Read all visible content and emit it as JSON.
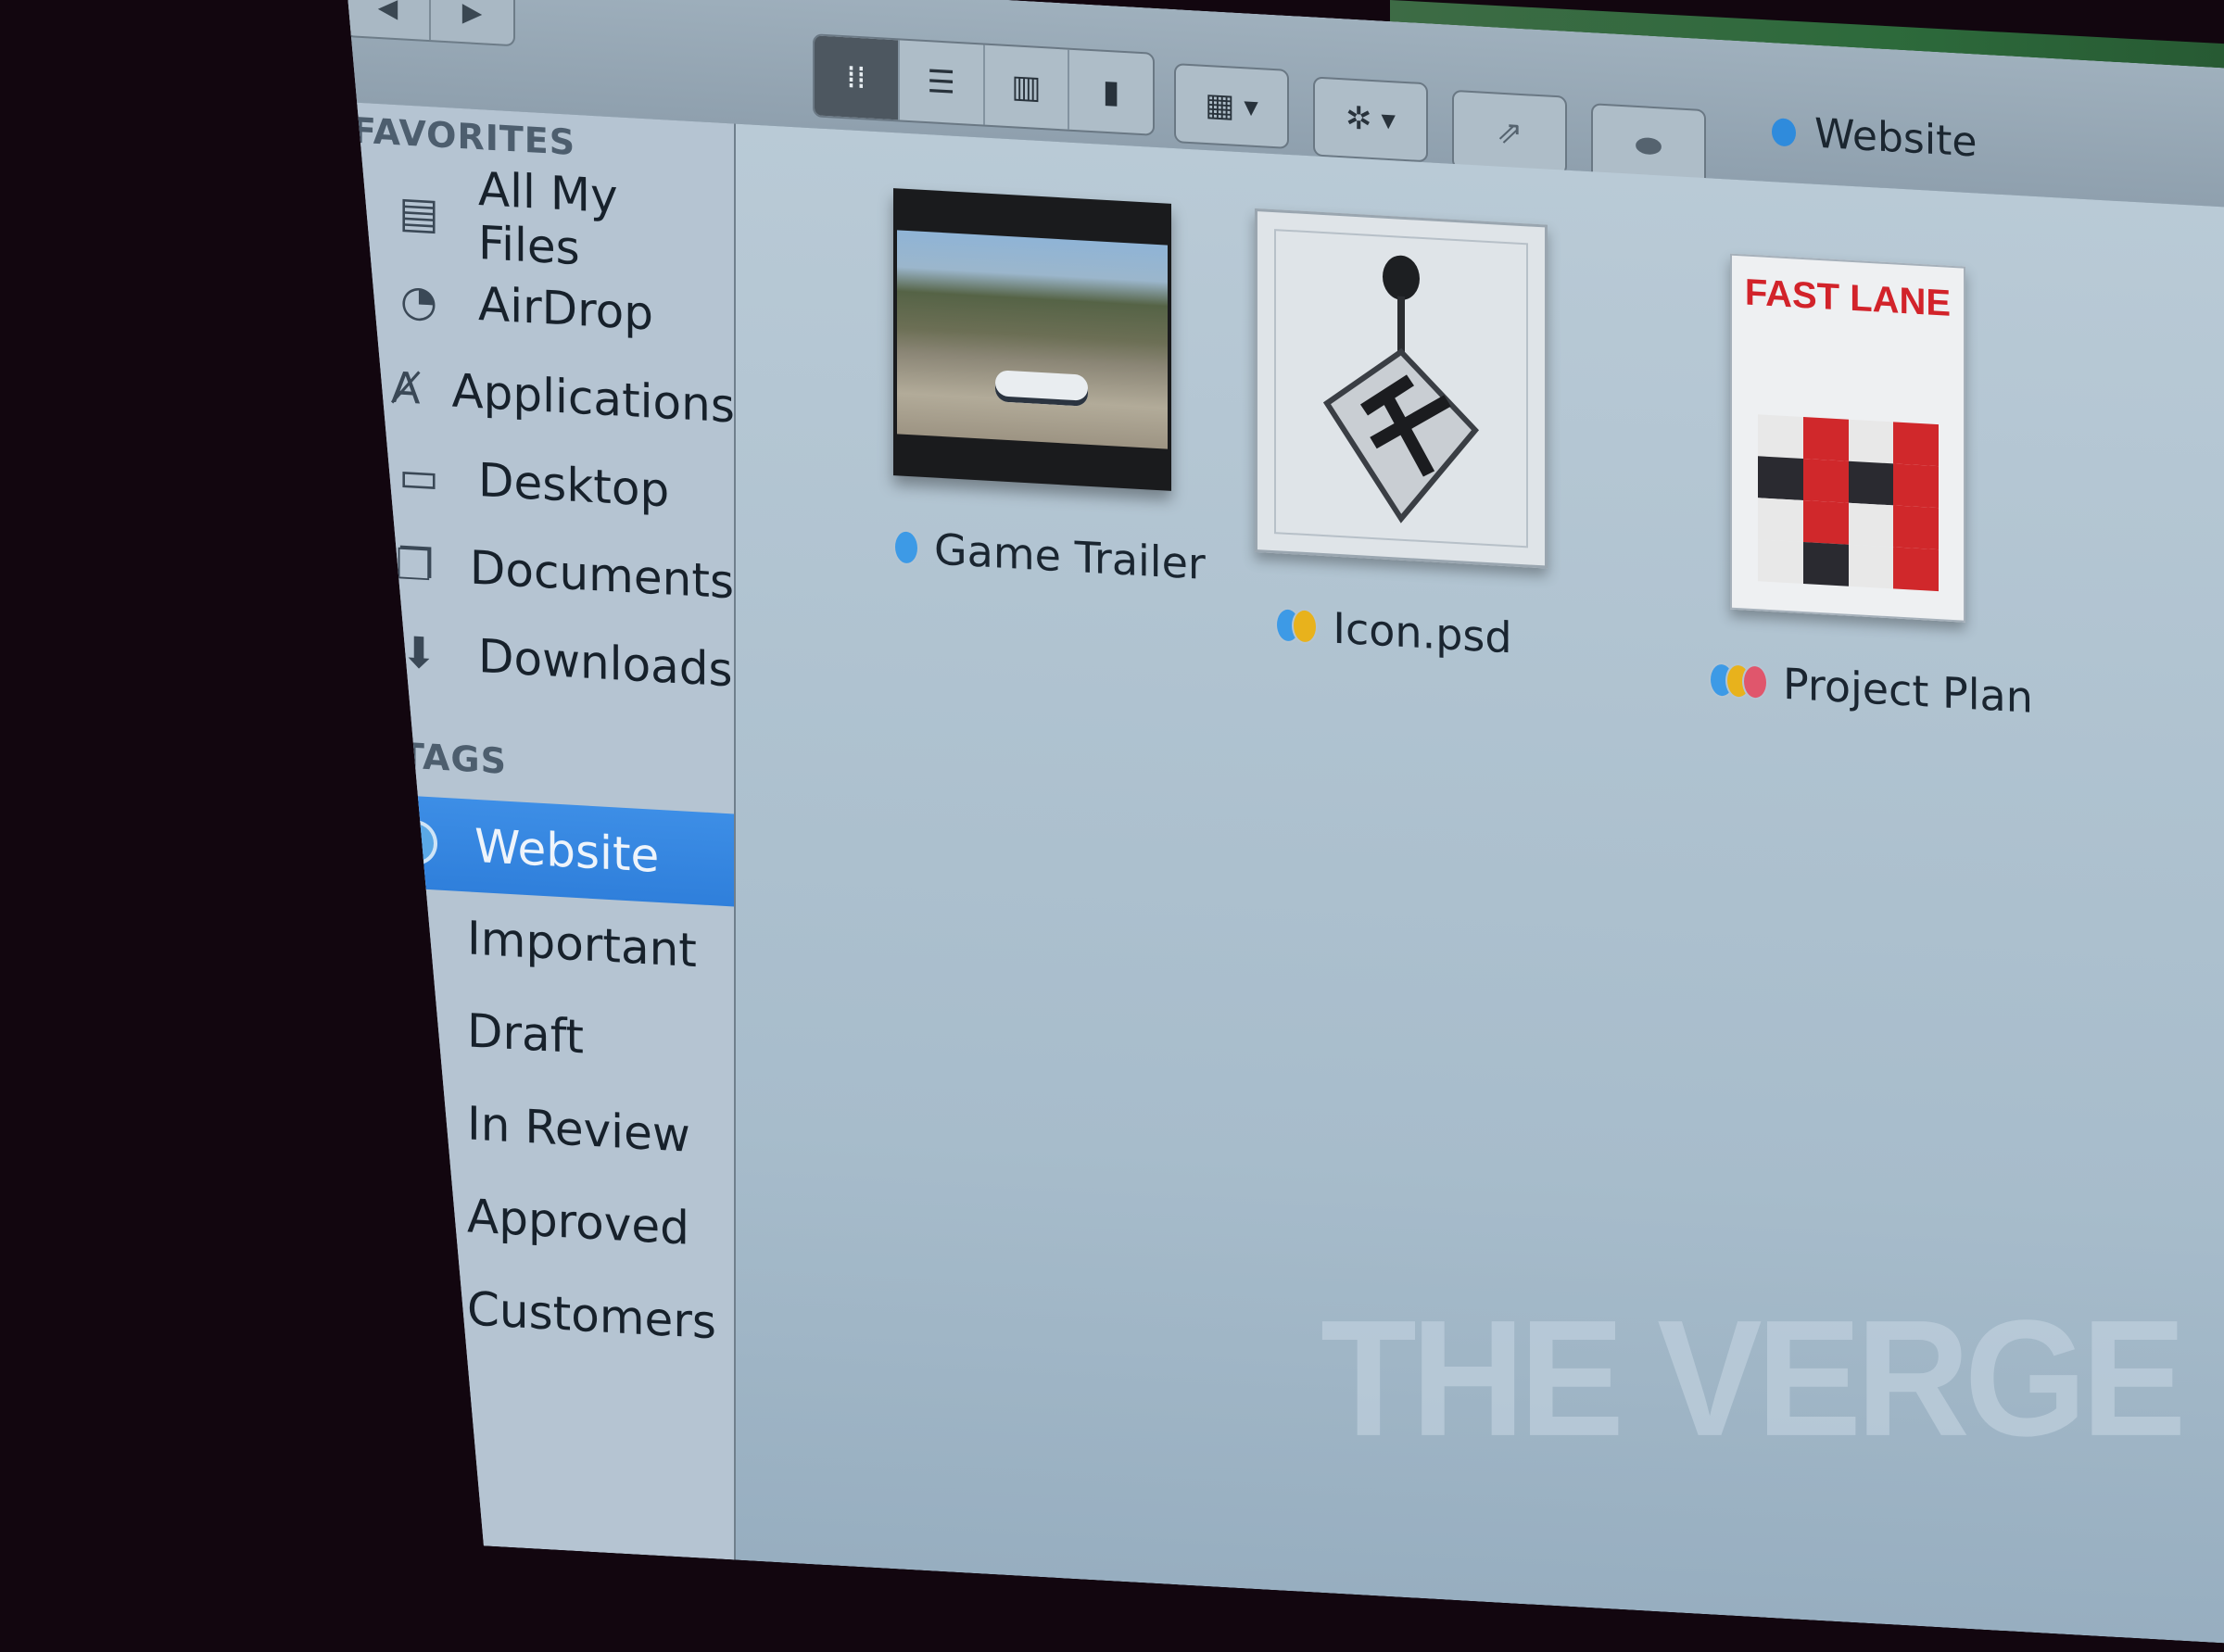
{
  "window": {
    "title": "Website",
    "title_tag_color": "#2f8bdc",
    "nav": {
      "back_icon": "◀",
      "forward_icon": "▶"
    }
  },
  "toolbar": {
    "view_buttons": [
      {
        "name": "icon-view",
        "glyph": "⁞⁞",
        "active": true
      },
      {
        "name": "list-view",
        "glyph": "☰",
        "active": false
      },
      {
        "name": "column-view",
        "glyph": "▥",
        "active": false
      },
      {
        "name": "cover-flow-view",
        "glyph": "▮",
        "active": false
      }
    ],
    "arrange_glyph": "▦",
    "action_glyph": "✲",
    "caret_glyph": "▼",
    "share_glyph": "⇗",
    "tags_glyph": "⬬"
  },
  "sidebar": {
    "favorites_label": "FAVORITES",
    "favorites": [
      {
        "label": "All My Files",
        "glyph": "▤"
      },
      {
        "label": "AirDrop",
        "glyph": "◔"
      },
      {
        "label": "Applications",
        "glyph": "Ⱥ"
      },
      {
        "label": "Desktop",
        "glyph": "▭"
      },
      {
        "label": "Documents",
        "glyph": "❐"
      },
      {
        "label": "Downloads",
        "glyph": "⬇"
      }
    ],
    "tags_label": "TAGS",
    "tags": [
      {
        "label": "Website",
        "color": "#5aa8e6",
        "selected": true
      },
      {
        "label": "Important",
        "color": "#e0566c",
        "selected": false
      },
      {
        "label": "Draft",
        "color": "#d6d41e",
        "selected": false
      },
      {
        "label": "In Review",
        "color": "#e08a22",
        "selected": false
      },
      {
        "label": "Approved",
        "color": "#4cc41e",
        "selected": false
      },
      {
        "label": "Customers",
        "color": "#b77be8",
        "selected": false
      }
    ]
  },
  "files": [
    {
      "name": "Game Trailer",
      "kind": "video",
      "tag_colors": [
        "#3d9ae6"
      ]
    },
    {
      "name": "Icon.psd",
      "kind": "psd",
      "tag_colors": [
        "#3d9ae6",
        "#e8b21c"
      ]
    },
    {
      "name": "Project Plan",
      "kind": "document",
      "doc_title": "FAST LANE",
      "tag_colors": [
        "#3d9ae6",
        "#e8b21c",
        "#e0566c"
      ]
    }
  ],
  "watermark": "THE VERGE"
}
